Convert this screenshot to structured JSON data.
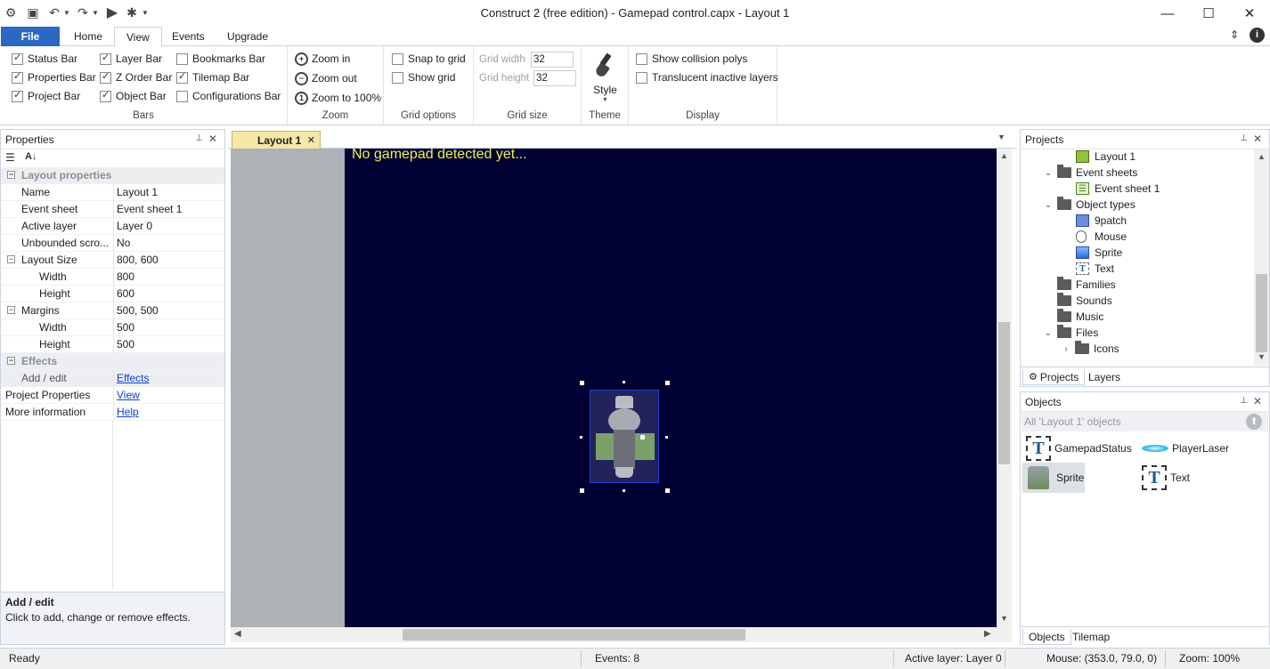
{
  "window": {
    "title": "Construct 2  (free edition) - Gamepad control.capx - Layout 1",
    "minimize": "—",
    "maximize": "☐",
    "close": "✕"
  },
  "ribbon_tabs": [
    {
      "label": "File"
    },
    {
      "label": "Home"
    },
    {
      "label": "View"
    },
    {
      "label": "Events"
    },
    {
      "label": "Upgrade"
    }
  ],
  "bars": {
    "group_label": "Bars",
    "items": [
      {
        "label": "Status Bar",
        "checked": true
      },
      {
        "label": "Properties Bar",
        "checked": true
      },
      {
        "label": "Project Bar",
        "checked": true
      },
      {
        "label": "Layer Bar",
        "checked": true
      },
      {
        "label": "Z Order Bar",
        "checked": true
      },
      {
        "label": "Object Bar",
        "checked": true
      },
      {
        "label": "Bookmarks Bar",
        "checked": false
      },
      {
        "label": "Tilemap Bar",
        "checked": true
      },
      {
        "label": "Configurations Bar",
        "checked": false
      }
    ]
  },
  "zoom": {
    "group_label": "Zoom",
    "zoom_in": "Zoom in",
    "zoom_out": "Zoom out",
    "zoom_100": "Zoom to 100%"
  },
  "grid_options": {
    "group_label": "Grid options",
    "snap": "Snap to grid",
    "show": "Show grid"
  },
  "grid_size": {
    "group_label": "Grid size",
    "width_label": "Grid width",
    "width_value": "32",
    "height_label": "Grid height",
    "height_value": "32"
  },
  "theme": {
    "group_label": "Theme",
    "style_label": "Style"
  },
  "display": {
    "group_label": "Display",
    "collision": "Show collision polys",
    "translucent": "Translucent inactive layers"
  },
  "properties": {
    "title": "Properties",
    "rows": {
      "layout_properties": "Layout properties",
      "name_k": "Name",
      "name_v": "Layout 1",
      "eventsheet_k": "Event sheet",
      "eventsheet_v": "Event sheet 1",
      "activelayer_k": "Active layer",
      "activelayer_v": "Layer 0",
      "unbounded_k": "Unbounded scro...",
      "unbounded_v": "No",
      "layoutsize_k": "Layout Size",
      "layoutsize_v": "800, 600",
      "ls_width_k": "Width",
      "ls_width_v": "800",
      "ls_height_k": "Height",
      "ls_height_v": "600",
      "margins_k": "Margins",
      "margins_v": "500, 500",
      "m_width_k": "Width",
      "m_width_v": "500",
      "m_height_k": "Height",
      "m_height_v": "500",
      "effects": "Effects",
      "addedit_k": "Add / edit",
      "addedit_v": "Effects",
      "projprops_k": "Project Properties",
      "projprops_v": "View",
      "moreinfo_k": "More information",
      "moreinfo_v": "Help"
    },
    "desc_title": "Add / edit",
    "desc_text": "Click to add, change or remove effects."
  },
  "editor": {
    "tab_label": "Layout 1",
    "canvas_text": "No gamepad detected yet..."
  },
  "projects": {
    "title": "Projects",
    "tree": {
      "layout1": "Layout 1",
      "event_sheets": "Event sheets",
      "event_sheet1": "Event sheet 1",
      "object_types": "Object types",
      "ninepatch": "9patch",
      "mouse": "Mouse",
      "sprite": "Sprite",
      "text": "Text",
      "families": "Families",
      "sounds": "Sounds",
      "music": "Music",
      "files": "Files",
      "icons": "Icons"
    },
    "tabs": {
      "projects": "Projects",
      "layers": "Layers"
    }
  },
  "objects": {
    "title": "Objects",
    "filter": "All 'Layout 1' objects",
    "items": {
      "gamepadstatus": "GamepadStatus",
      "playerlaser": "PlayerLaser",
      "sprite": "Sprite",
      "text": "Text"
    },
    "tabs": {
      "objects": "Objects",
      "tilemap": "Tilemap"
    }
  },
  "status": {
    "ready": "Ready",
    "events": "Events: 8",
    "active_layer": "Active layer: Layer 0",
    "mouse": "Mouse: (353.0, 79.0, 0)",
    "zoom": "Zoom: 100%"
  },
  "colors": {
    "file_tab": "#2b67c3",
    "layout_bg": "#000033",
    "canvas_text": "#f4f04a"
  }
}
